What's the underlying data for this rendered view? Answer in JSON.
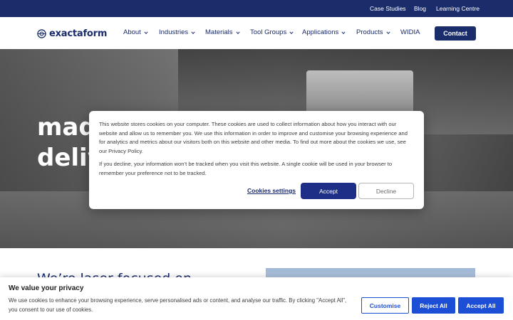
{
  "topbar": {
    "links": [
      "Case Studies",
      "Blog",
      "Learning Centre"
    ]
  },
  "nav": {
    "logo_text": "exactaform",
    "items": [
      {
        "label": "About",
        "dropdown": true
      },
      {
        "label": "Industries",
        "dropdown": true
      },
      {
        "label": "Materials",
        "dropdown": true
      },
      {
        "label": "Tool Groups",
        "dropdown": true
      },
      {
        "label": "Applications",
        "dropdown": true
      },
      {
        "label": "Products",
        "dropdown": true
      },
      {
        "label": "WIDIA",
        "dropdown": false
      }
    ],
    "contact_label": "Contact"
  },
  "hero": {
    "line1": "mad",
    "line2": "deliv"
  },
  "cookie_modal": {
    "text1": "This website stores cookies on your computer. These cookies are used to collect information about how you interact with our website and allow us to remember you. We use this information in order to improve and customise your browsing experience and for analytics and metrics about our visitors both on this website and other media. To find out more about the cookies we use, see our Privacy Policy.",
    "text2": "If you decline, your information won’t be tracked when you visit this website. A single cookie will be used in your browser to remember your preference not to be tracked.",
    "settings_label": "Cookies settings",
    "accept_label": "Accept",
    "decline_label": "Decline"
  },
  "section": {
    "heading": "We’re laser focused on"
  },
  "privacy_banner": {
    "title": "We value your privacy",
    "text": "We use cookies to enhance your browsing experience, serve personalised ads or content, and analyse our traffic. By clicking \"Accept All\", you consent to our use of cookies.",
    "customise_label": "Customise",
    "reject_label": "Reject All",
    "accept_all_label": "Accept All"
  },
  "colors": {
    "brand_navy": "#1b2c6b",
    "button_blue": "#1d4fd6",
    "accept_blue": "#1d2f86"
  },
  "icons": {
    "logo": "exactaform-logo-icon",
    "dropdown": "chevron-down-icon"
  }
}
